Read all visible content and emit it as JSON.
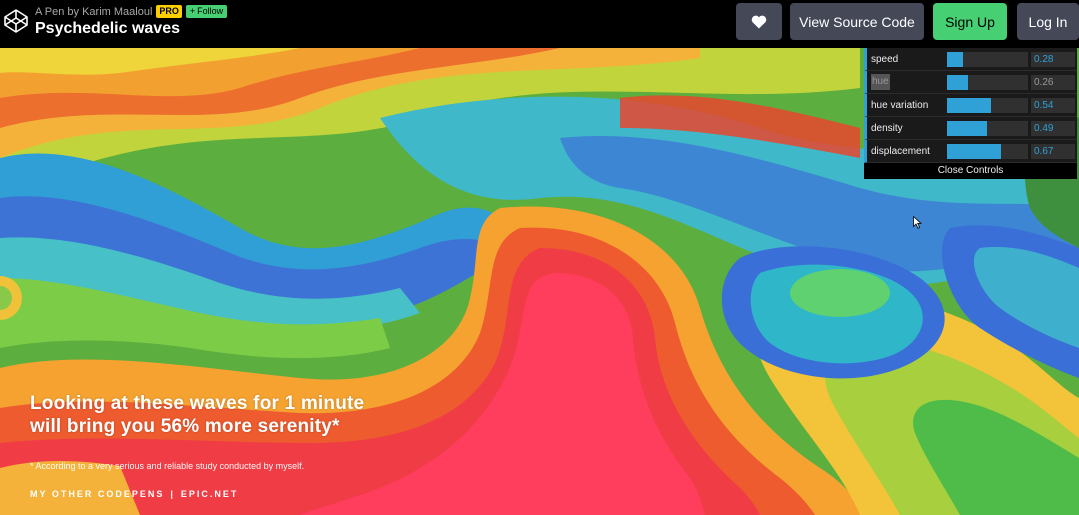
{
  "header": {
    "by_line": "A Pen by Karim Maaloul",
    "pro_badge": "PRO",
    "follow_label": "Follow",
    "title": "Psychedelic waves",
    "buttons": {
      "heart_icon": "heart-icon",
      "view_source": "View Source Code",
      "sign_up": "Sign Up",
      "log_in": "Log In"
    }
  },
  "controls": {
    "params": [
      {
        "label": "speed",
        "value": "0.28",
        "fraction": 0.2
      },
      {
        "label": "hue",
        "value": "0.26",
        "fraction": 0.26
      },
      {
        "label": "hue variation",
        "value": "0.54",
        "fraction": 0.54
      },
      {
        "label": "density",
        "value": "0.49",
        "fraction": 0.49
      },
      {
        "label": "displacement",
        "value": "0.67",
        "fraction": 0.67
      }
    ],
    "close_label": "Close Controls"
  },
  "overlay": {
    "headline_1": "Looking at these waves for 1 minute",
    "headline_2": "will bring you 56% more serenity*",
    "footnote": "* According to a very serious and reliable study conducted by myself.",
    "link_1": "MY OTHER CODEPENS",
    "separator": "|",
    "link_2": "EPIC.NET"
  },
  "colors": {
    "brand_green": "#47cf73",
    "button_gray": "#444857",
    "gui_accent": "#2fa1d6",
    "pro_yellow": "#fcd000"
  }
}
